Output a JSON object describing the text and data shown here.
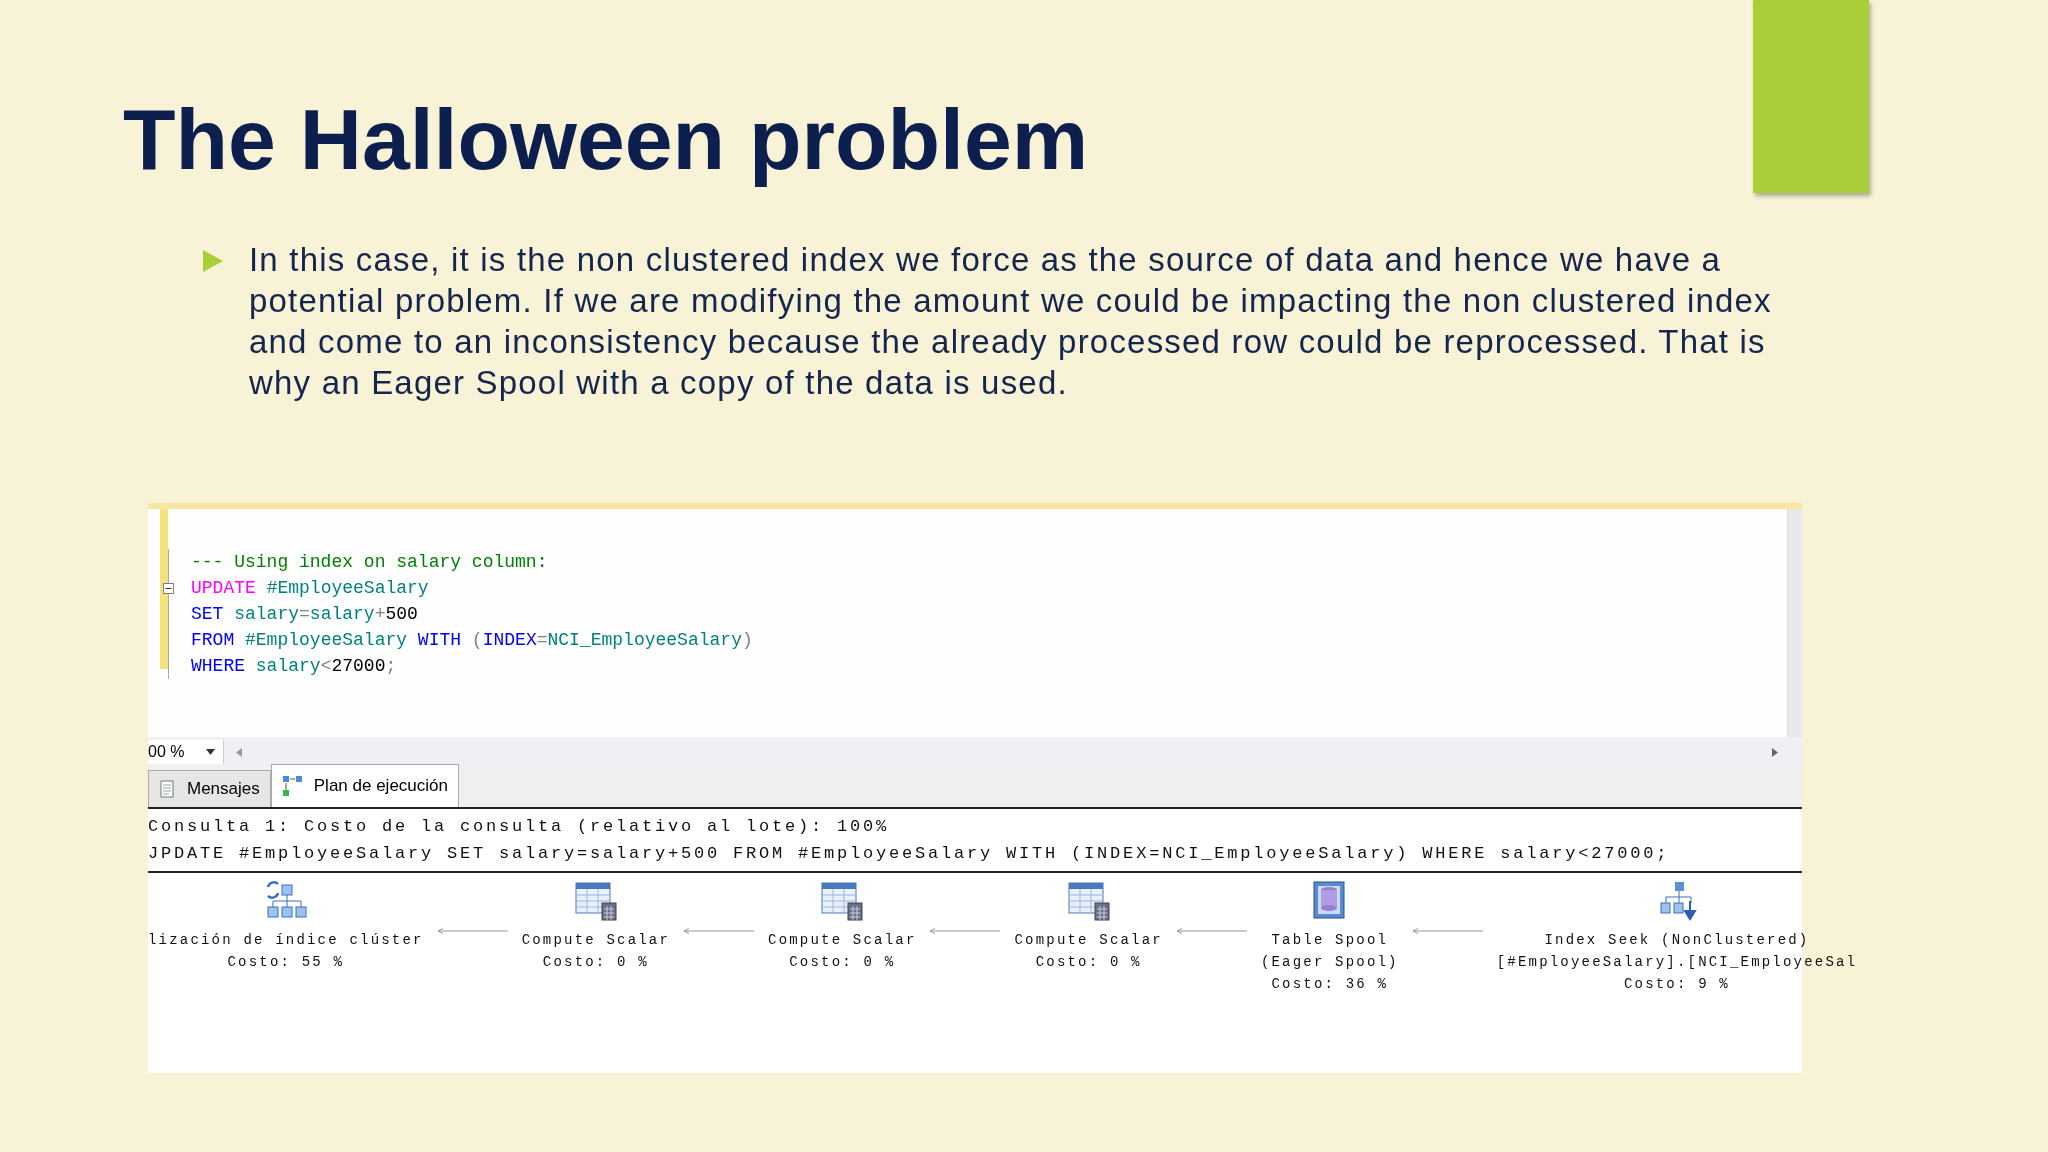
{
  "title": "The Halloween problem",
  "bullets": [
    "In this case, it is the non clustered index we force as the source of data and hence we have a potential problem. If we are modifying the amount we could be impacting the non clustered index and come to an inconsistency because the already processed row could be reprocessed. That is why an Eager Spool with a copy of the data is used."
  ],
  "editor": {
    "lines": [
      {
        "collapsible": false,
        "tokens": [
          {
            "kind": "comment",
            "text": "--- Using index on salary column:"
          }
        ]
      },
      {
        "collapsible": true,
        "tokens": [
          {
            "kind": "pink",
            "text": "UPDATE "
          },
          {
            "kind": "ident",
            "text": "#EmployeeSalary"
          }
        ]
      },
      {
        "collapsible": false,
        "tokens": [
          {
            "kind": "keyword",
            "text": "SET "
          },
          {
            "kind": "ident",
            "text": "salary"
          },
          {
            "kind": "op",
            "text": "="
          },
          {
            "kind": "ident",
            "text": "salary"
          },
          {
            "kind": "op",
            "text": "+"
          },
          {
            "kind": "plain",
            "text": "500"
          }
        ]
      },
      {
        "collapsible": false,
        "tokens": [
          {
            "kind": "keyword",
            "text": "FROM "
          },
          {
            "kind": "ident",
            "text": "#EmployeeSalary "
          },
          {
            "kind": "keyword",
            "text": "WITH "
          },
          {
            "kind": "op",
            "text": "("
          },
          {
            "kind": "keyword",
            "text": "INDEX"
          },
          {
            "kind": "op",
            "text": "="
          },
          {
            "kind": "ident",
            "text": "NCI_EmployeeSalary"
          },
          {
            "kind": "op",
            "text": ")"
          }
        ]
      },
      {
        "collapsible": false,
        "tokens": [
          {
            "kind": "keyword",
            "text": "WHERE "
          },
          {
            "kind": "ident",
            "text": "salary"
          },
          {
            "kind": "op",
            "text": "<"
          },
          {
            "kind": "plain",
            "text": "27000"
          },
          {
            "kind": "op",
            "text": ";"
          }
        ]
      }
    ]
  },
  "zoom": "00 %",
  "tabs": [
    {
      "label": "Mensajes",
      "kind": "messages",
      "selected": false
    },
    {
      "label": "Plan de ejecución",
      "kind": "plan",
      "selected": true
    }
  ],
  "results": [
    "Consulta 1: Costo de la consulta (relativo al lote): 100%",
    "JPDATE #EmployeeSalary SET salary=salary+500 FROM #EmployeeSalary WITH (INDEX=NCI_EmployeeSalary) WHERE salary<27000;"
  ],
  "plan": [
    {
      "kind": "update",
      "lines": [
        "lización de índice clúster",
        "Costo: 55 %"
      ]
    },
    {
      "kind": "compute",
      "lines": [
        "Compute Scalar",
        "Costo: 0 %"
      ]
    },
    {
      "kind": "compute",
      "lines": [
        "Compute Scalar",
        "Costo: 0 %"
      ]
    },
    {
      "kind": "compute",
      "lines": [
        "Compute Scalar",
        "Costo: 0 %"
      ]
    },
    {
      "kind": "spool",
      "lines": [
        "Table Spool",
        "(Eager Spool)",
        "Costo: 36 %"
      ]
    },
    {
      "kind": "seek",
      "lines": [
        "Index Seek (NonClustered)",
        "[#EmployeeSalary].[NCI_EmployeeSal",
        "Costo: 9 %"
      ]
    }
  ]
}
